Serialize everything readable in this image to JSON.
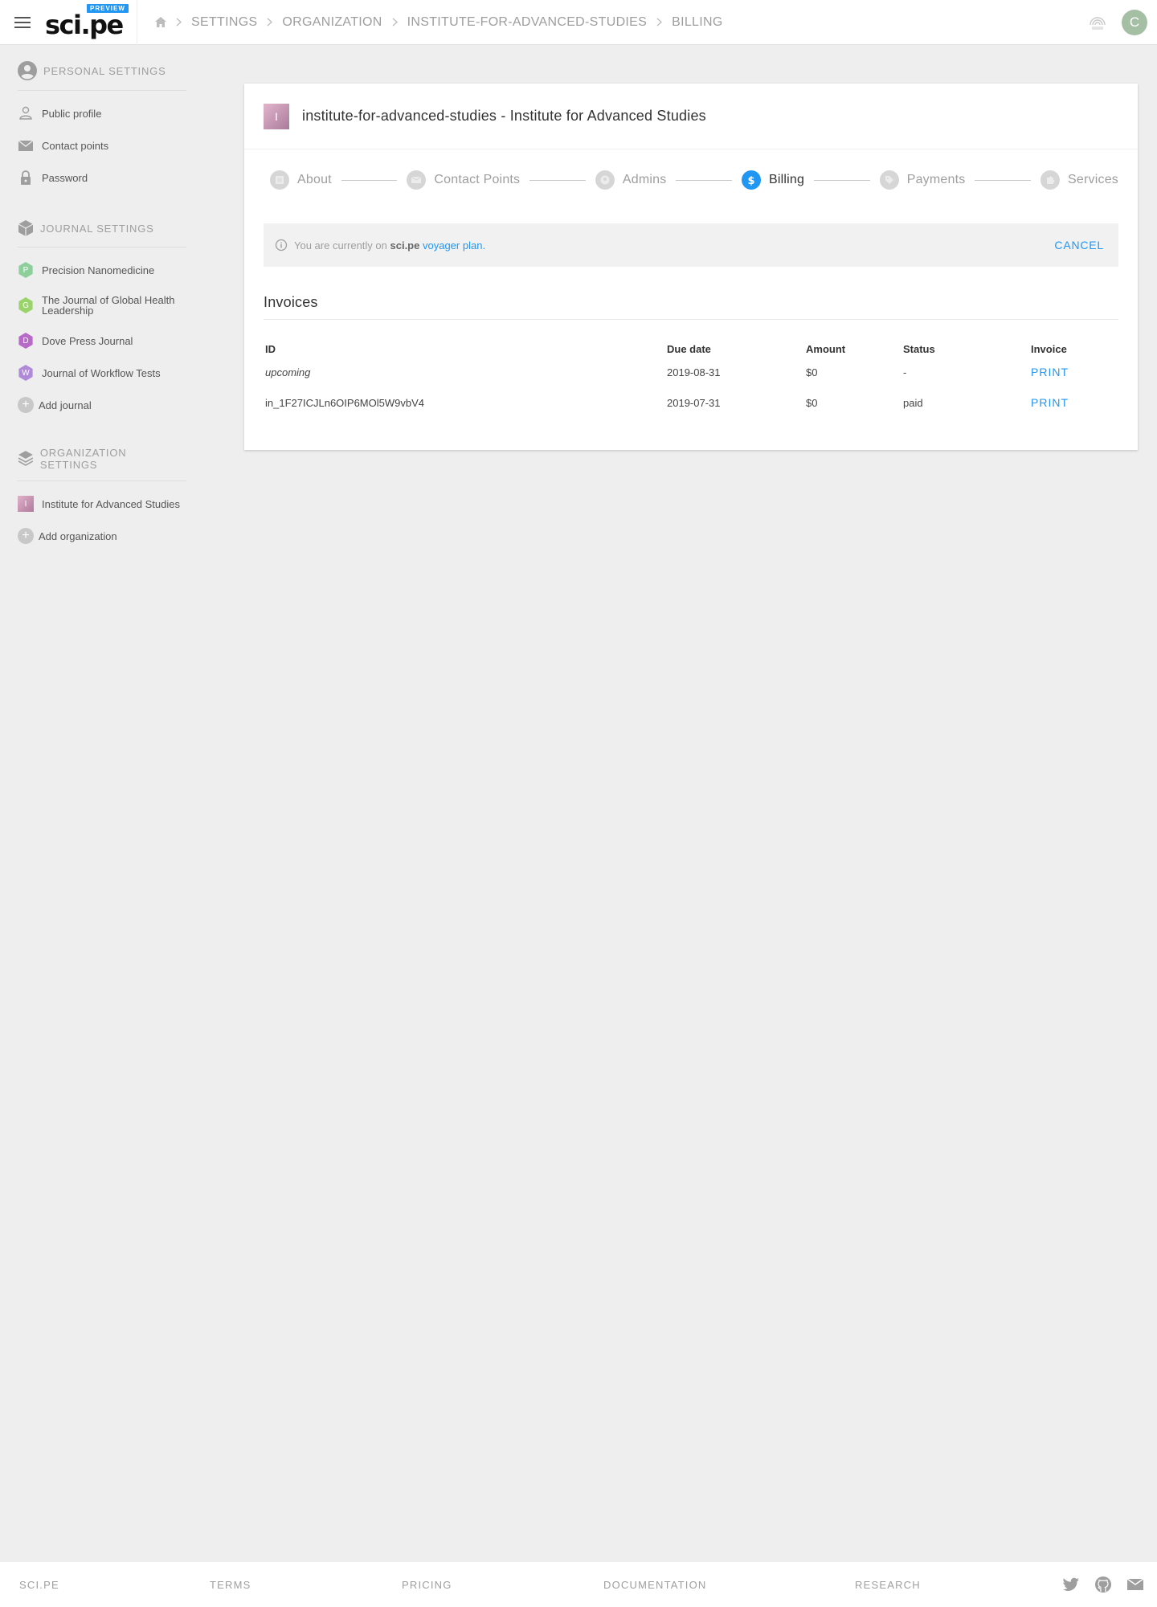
{
  "header": {
    "logo_text": "sci.pe",
    "logo_badge": "PREVIEW",
    "breadcrumb": [
      "SETTINGS",
      "ORGANIZATION",
      "INSTITUTE-FOR-ADVANCED-STUDIES",
      "BILLING"
    ],
    "avatar_letter": "C"
  },
  "sidebar": {
    "personal_heading": "PERSONAL SETTINGS",
    "personal_items": [
      "Public profile",
      "Contact points",
      "Password"
    ],
    "journal_heading": "JOURNAL SETTINGS",
    "journals": [
      {
        "letter": "P",
        "name": "Precision Nanomedicine",
        "color": "#8ccf9a"
      },
      {
        "letter": "G",
        "name": "The Journal of Global Health Leadership",
        "color": "#9ad36a"
      },
      {
        "letter": "D",
        "name": "Dove Press Journal",
        "color": "#b86ac8"
      },
      {
        "letter": "W",
        "name": "Journal of Workflow Tests",
        "color": "#b08ad8"
      }
    ],
    "add_journal": "Add journal",
    "org_heading": "ORGANIZATION SETTINGS",
    "orgs": [
      {
        "letter": "I",
        "name": "Institute for Advanced Studies"
      }
    ],
    "add_org": "Add organization"
  },
  "card": {
    "logo_letter": "I",
    "title": "institute-for-advanced-studies - Institute for Advanced Studies",
    "steps": [
      "About",
      "Contact Points",
      "Admins",
      "Billing",
      "Payments",
      "Services"
    ],
    "active_step": "Billing",
    "plan": {
      "prefix": "You are currently on",
      "brand": "sci.pe",
      "plan_link": "voyager plan",
      "suffix": ".",
      "cancel": "CANCEL"
    },
    "invoices_title": "Invoices",
    "table": {
      "headers": [
        "ID",
        "Due date",
        "Amount",
        "Status",
        "Invoice"
      ],
      "rows": [
        {
          "id": "upcoming",
          "due": "2019-08-31",
          "amount": "$0",
          "status": "-",
          "action": "PRINT"
        },
        {
          "id": "in_1F27ICJLn6OIP6MOl5W9vbV4",
          "due": "2019-07-31",
          "amount": "$0",
          "status": "paid",
          "action": "PRINT"
        }
      ]
    }
  },
  "footer": {
    "links": [
      "SCI.PE",
      "TERMS",
      "PRICING",
      "DOCUMENTATION",
      "RESEARCH"
    ],
    "icons": [
      "twitter-icon",
      "github-icon",
      "mail-icon"
    ]
  },
  "colors": {
    "accent": "#2196f3",
    "background": "#eeeeee"
  }
}
